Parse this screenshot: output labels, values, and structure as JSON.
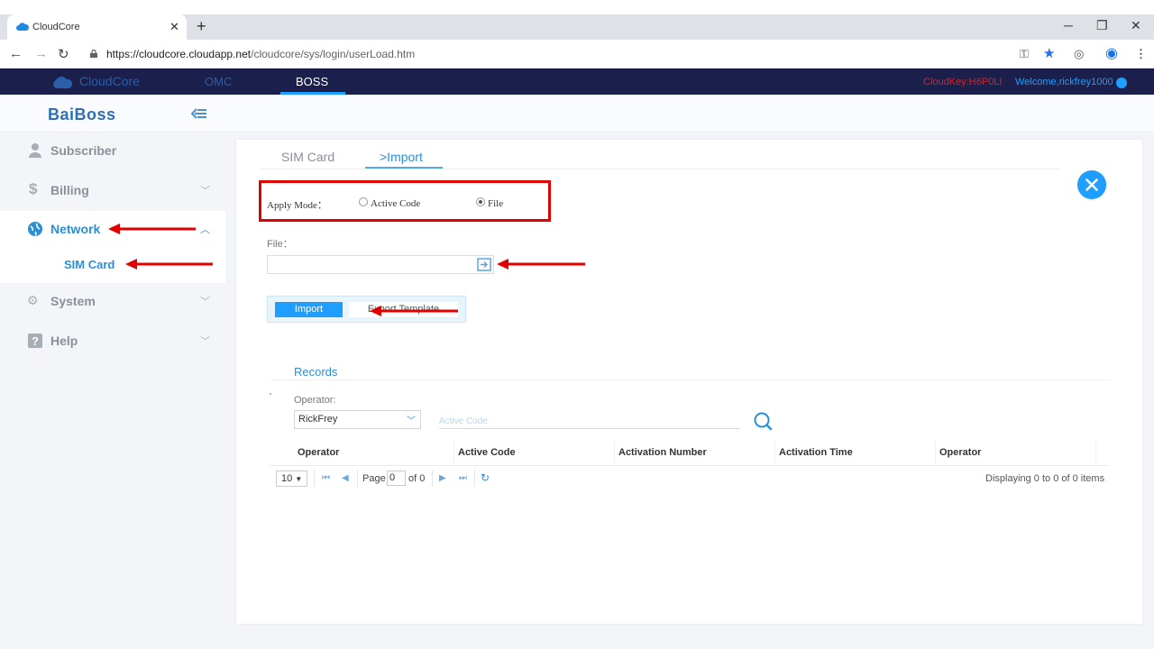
{
  "browser": {
    "tab_title": "CloudCore",
    "new_tab": "+",
    "url_host": "https://cloudcore.cloudapp.net",
    "url_path": "/cloudcore/sys/login/userLoad.htm"
  },
  "app_nav": {
    "logo": "CloudCore",
    "tabs": [
      "OMC",
      "BOSS"
    ],
    "cloudkey": "CloudKey:H6P0LI",
    "welcome": "Welcome,rickfrey1000"
  },
  "brand": "BaiBoss",
  "sidebar": {
    "items": [
      {
        "label": "Subscriber",
        "icon": "user-icon"
      },
      {
        "label": "Billing",
        "icon": "dollar-icon"
      },
      {
        "label": "Network",
        "icon": "globe-icon"
      },
      {
        "label": "SIM Card"
      },
      {
        "label": "System",
        "icon": "gears-icon"
      },
      {
        "label": "Help",
        "icon": "help-icon"
      }
    ]
  },
  "tabs": {
    "sim": "SIM Card",
    "import": ">Import"
  },
  "form": {
    "apply_mode_label": "Apply Mode：",
    "options": [
      "Active Code",
      "File"
    ],
    "selected": "File",
    "file_label": "File：",
    "import_button": "Import",
    "export_button": "Export Template"
  },
  "records": {
    "title": "Records",
    "operator_label": "Operator:",
    "operator_value": "RickFrey",
    "active_code_placeholder": "Active Code",
    "columns": [
      "Operator",
      "Active Code",
      "Activation Number",
      "Activation Time",
      "Operator"
    ]
  },
  "pager": {
    "page_size": "10",
    "page_label": "Page",
    "page_value": "0",
    "of_label": "of 0",
    "display": "Displaying 0 to 0 of 0 items"
  },
  "colors": {
    "accent": "#1e9fff",
    "annotation": "#e00000",
    "nav_bg": "#1b1f4b"
  }
}
